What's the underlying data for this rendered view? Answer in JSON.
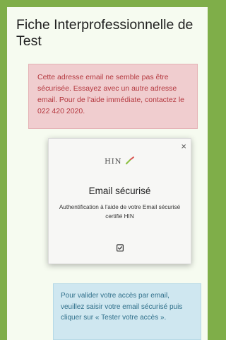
{
  "page": {
    "title": "Fiche Interprofessionnelle de Test"
  },
  "error_alert": {
    "text": "Cette adresse email ne semble pas être sécurisée. Essayez avec un autre adresse email. Pour de l'aide immédiate, contactez le 022 420 2020."
  },
  "modal": {
    "close_label": "×",
    "logo_text": "HIN",
    "logo_icon": "hin-logo-icon",
    "title": "Email sécurisé",
    "description": "Authentification à l'aide de votre Email sécurisé certifié HIN",
    "icon": "checkbox-check-icon"
  },
  "info_alert": {
    "text": "Pour valider votre accès par email, veuillez saisir votre email sécurisé puis cliquer sur « Tester votre accès »."
  },
  "colors": {
    "background": "#7fae49",
    "page": "#f6fbf0",
    "error_bg": "#f0cdcf",
    "error_text": "#b4383f",
    "info_bg": "#cfe7f0",
    "info_text": "#2f6f8a",
    "logo_green": "#8bbf3f",
    "logo_red": "#d9534f"
  }
}
